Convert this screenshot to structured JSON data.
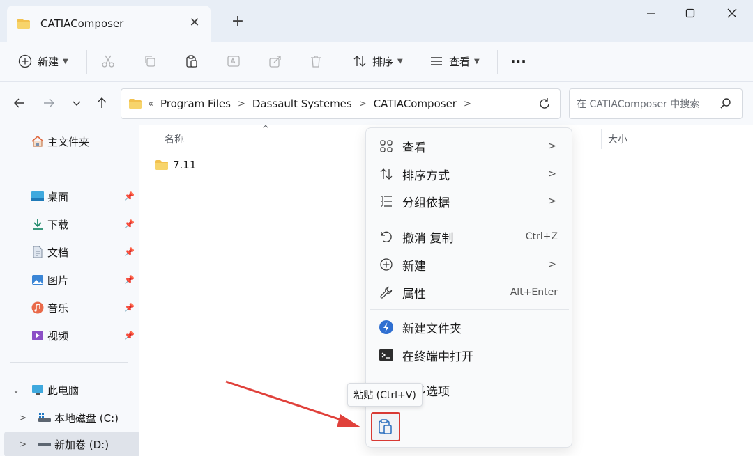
{
  "window": {
    "tab_title": "CATIAComposer",
    "new_tab_label": "+",
    "close_tab_label": "✕",
    "minimize_label": "—",
    "maximize_label": "☐",
    "close_label": "✕"
  },
  "toolbar": {
    "new_label": "新建",
    "sort_label": "排序",
    "view_label": "查看",
    "more_label": "···"
  },
  "address": {
    "overflow": "«",
    "crumbs": [
      "Program Files",
      "Dassault Systemes",
      "CATIAComposer"
    ],
    "search_placeholder": "在 CATIAComposer 中搜索"
  },
  "sidebar": {
    "home": "主文件夹",
    "pinned": [
      {
        "label": "桌面",
        "icon": "desktop-icon"
      },
      {
        "label": "下载",
        "icon": "download-icon"
      },
      {
        "label": "文档",
        "icon": "document-icon"
      },
      {
        "label": "图片",
        "icon": "pictures-icon"
      },
      {
        "label": "音乐",
        "icon": "music-icon"
      },
      {
        "label": "视频",
        "icon": "video-icon"
      }
    ],
    "this_pc": "此电脑",
    "drives": [
      {
        "label": "本地磁盘 (C:)"
      },
      {
        "label": "新加卷 (D:)"
      }
    ]
  },
  "filelist": {
    "col_name": "名称",
    "col_size": "大小",
    "files": [
      {
        "name": "7.11",
        "type": "folder"
      }
    ]
  },
  "context_menu": {
    "items": [
      {
        "label": "查看",
        "icon": "grid-icon",
        "submenu": true
      },
      {
        "label": "排序方式",
        "icon": "sort-icon",
        "submenu": true
      },
      {
        "label": "分组依据",
        "icon": "group-icon",
        "submenu": true
      },
      {
        "label": "撤消 复制",
        "icon": "undo-icon",
        "shortcut": "Ctrl+Z"
      },
      {
        "label": "新建",
        "icon": "new-icon",
        "submenu": true
      },
      {
        "label": "属性",
        "icon": "wrench-icon",
        "shortcut": "Alt+Enter"
      },
      {
        "label": "新建文件夹",
        "icon": "new-folder-icon"
      },
      {
        "label": "在终端中打开",
        "icon": "terminal-icon"
      },
      {
        "label": "更多选项",
        "icon": "more-options-icon"
      }
    ],
    "tooltip": "粘贴 (Ctrl+V)"
  },
  "colors": {
    "accent_red": "#d83a34",
    "folder_yellow": "#f2c14e"
  }
}
